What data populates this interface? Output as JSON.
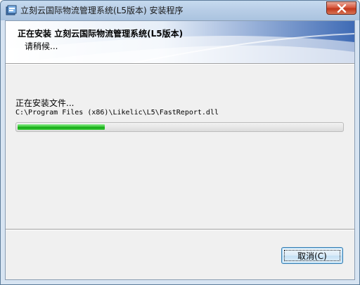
{
  "window": {
    "title": "立刻云国际物流管理系统(L5版本) 安装程序",
    "app_icon": "installer-icon",
    "close_icon": "close-icon"
  },
  "header": {
    "title": "正在安装  立刻云国际物流管理系统(L5版本)",
    "subtitle": "请稍候..."
  },
  "main": {
    "status_label": "正在安装文件...",
    "file_path": "C:\\Program Files (x86)\\Likelic\\L5\\FastReport.dll",
    "progress_fraction": 0.27
  },
  "footer": {
    "cancel_label": "取消(C)"
  },
  "colors": {
    "progress_fill": "#22b522",
    "title_bar": "#b9cfe8",
    "close_button": "#c8452a"
  }
}
